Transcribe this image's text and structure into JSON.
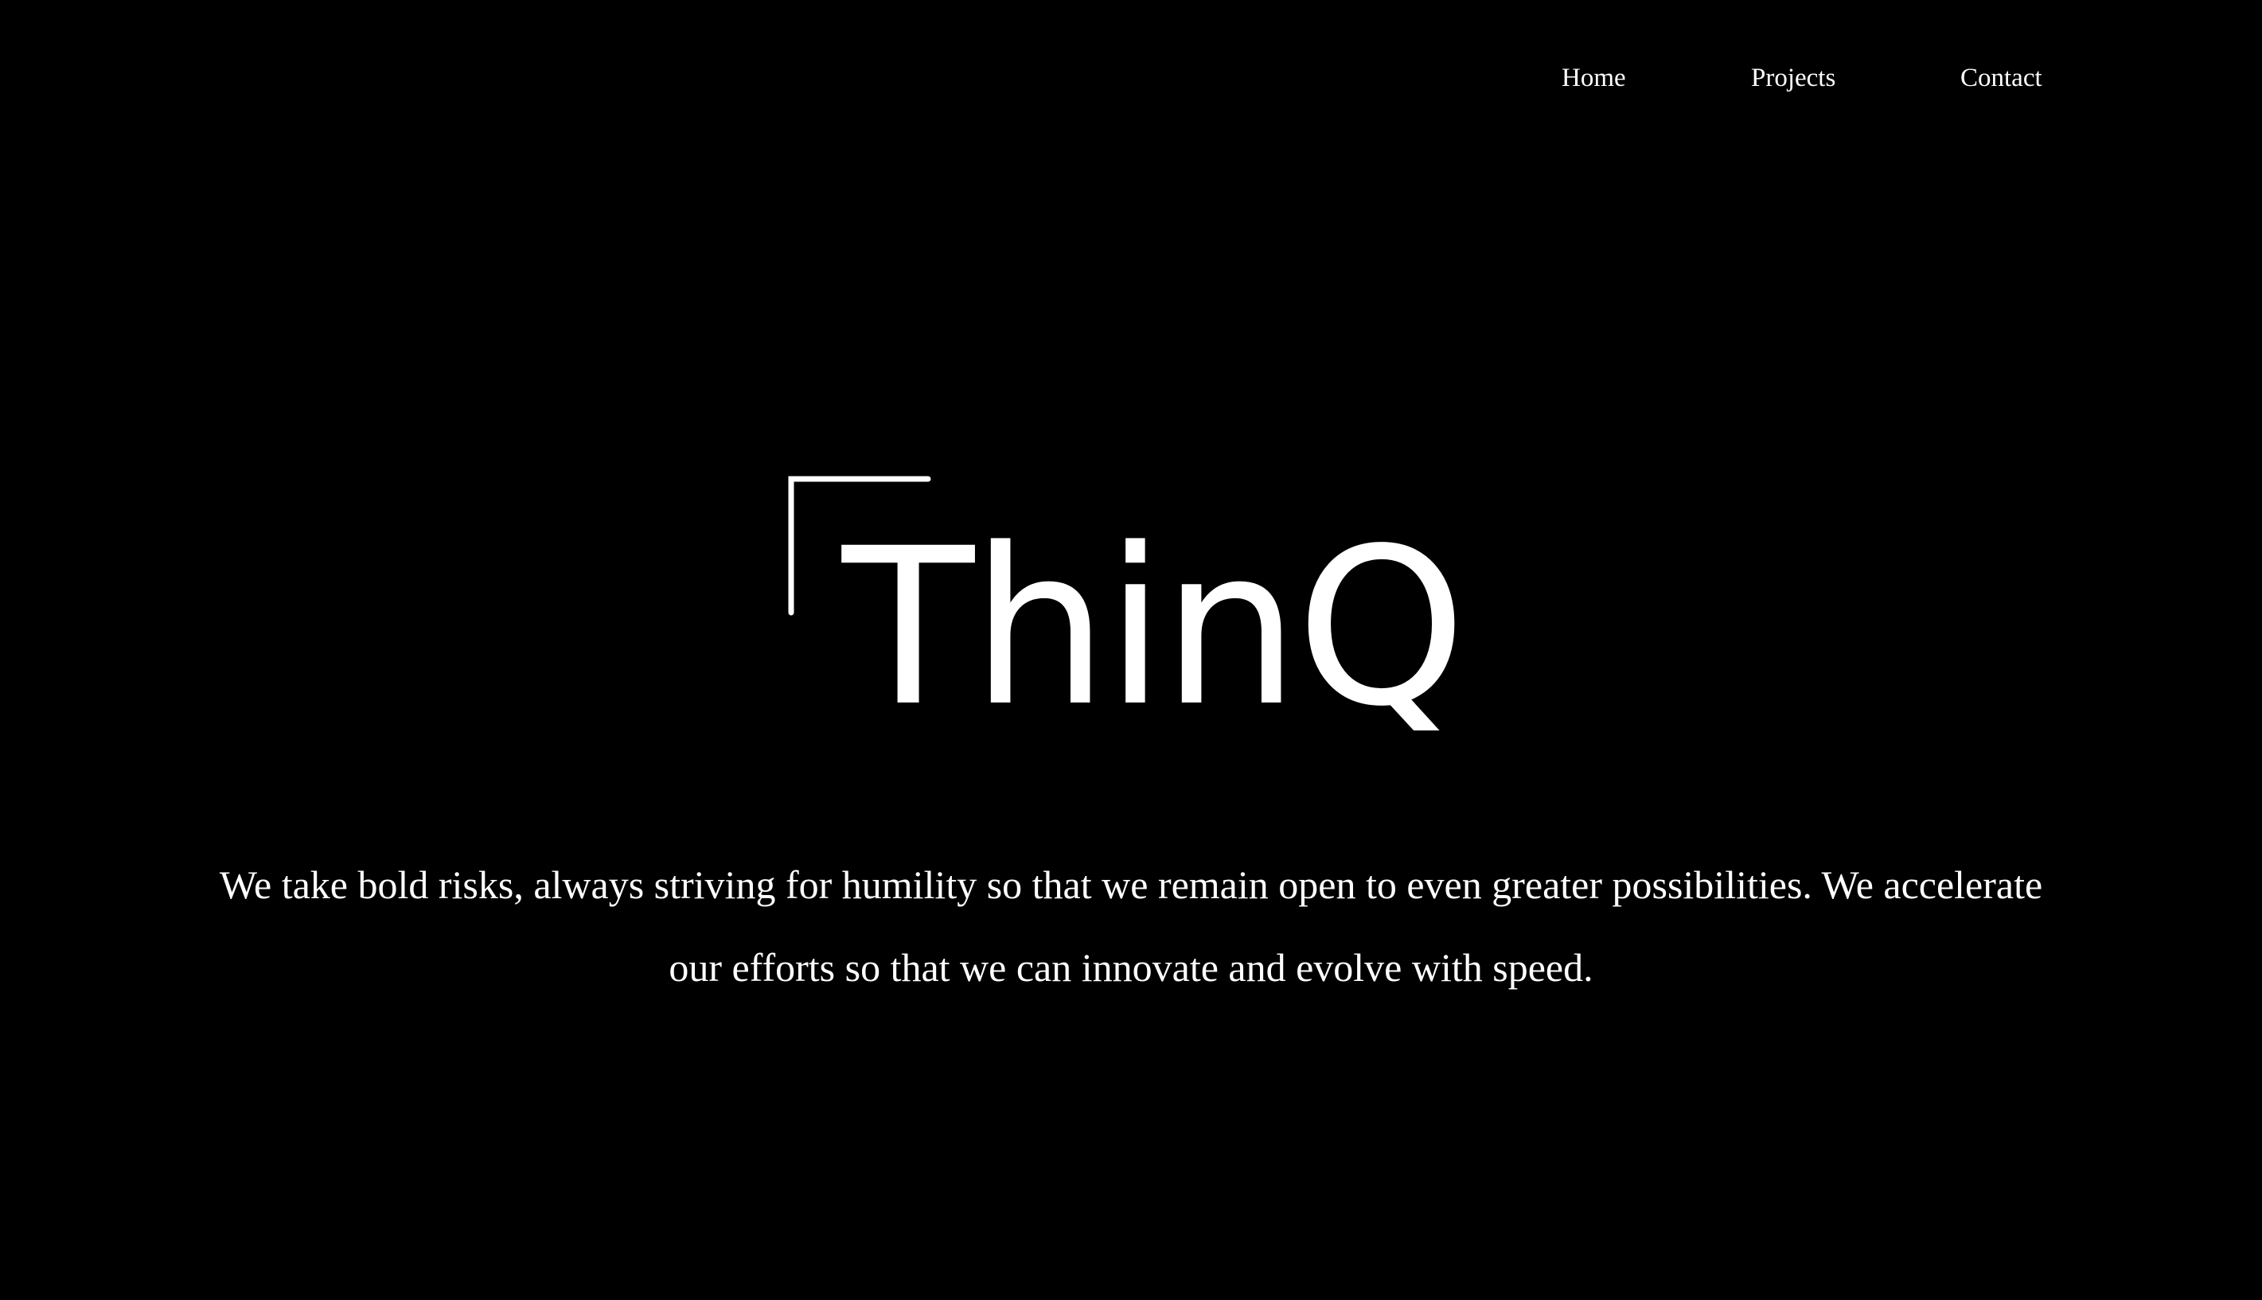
{
  "nav": {
    "items": [
      {
        "label": "Home"
      },
      {
        "label": "Projects"
      },
      {
        "label": "Contact"
      }
    ]
  },
  "hero": {
    "logo_text": "ThinQ",
    "logo_bracket_icon": "corner-bracket-icon",
    "tagline_lines": [
      "We take bold risks, always striving for humility so that we remain open to even greater possibilities. We accelerate",
      "our efforts so that we can innovate and evolve with speed."
    ]
  },
  "colors": {
    "background": "#000000",
    "text": "#ffffff"
  }
}
